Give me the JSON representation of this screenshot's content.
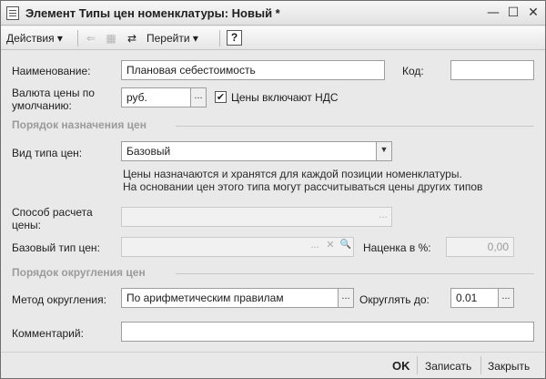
{
  "window": {
    "title": "Элемент Типы цен номенклатуры: Новый *",
    "minimize_glyph": "—",
    "maximize_glyph": "☐",
    "close_glyph": "✕"
  },
  "toolbar": {
    "actions_label": "Действия",
    "navigate_label": "Перейти",
    "help_label": "?",
    "dropdown_glyph": "▾"
  },
  "form": {
    "name_label": "Наименование:",
    "name_value": "Плановая себестоимость",
    "code_label": "Код:",
    "code_value": "",
    "currency_label": "Валюта цены по умолчанию:",
    "currency_value": "руб.",
    "vat_checkbox_label": "Цены включают НДС",
    "vat_checked": "✔",
    "section_assignment": "Порядок назначения цен",
    "price_type_label": "Вид типа цен:",
    "price_type_value": "Базовый",
    "hint_line1": "Цены назначаются и хранятся для каждой позиции номенклатуры.",
    "hint_line2": "На основании цен этого типа могут рассчитываться цены других типов",
    "calc_method_label": "Способ расчета цены:",
    "calc_method_value": "",
    "base_type_label": "Базовый тип цен:",
    "base_type_value": "",
    "markup_label": "Наценка в %:",
    "markup_value": "0,00",
    "section_rounding": "Порядок округления цен",
    "rounding_method_label": "Метод округления:",
    "rounding_method_value": "По арифметическим правилам",
    "round_to_label": "Округлять до:",
    "round_to_value": "0.01",
    "comment_label": "Комментарий:",
    "comment_value": "",
    "ellipsis": "...",
    "clear_glyph": "✕",
    "search_glyph": "🔍",
    "dropdown_arrow": "▼"
  },
  "buttons": {
    "ok_label": "OK",
    "save_label": "Записать",
    "close_label": "Закрыть"
  }
}
